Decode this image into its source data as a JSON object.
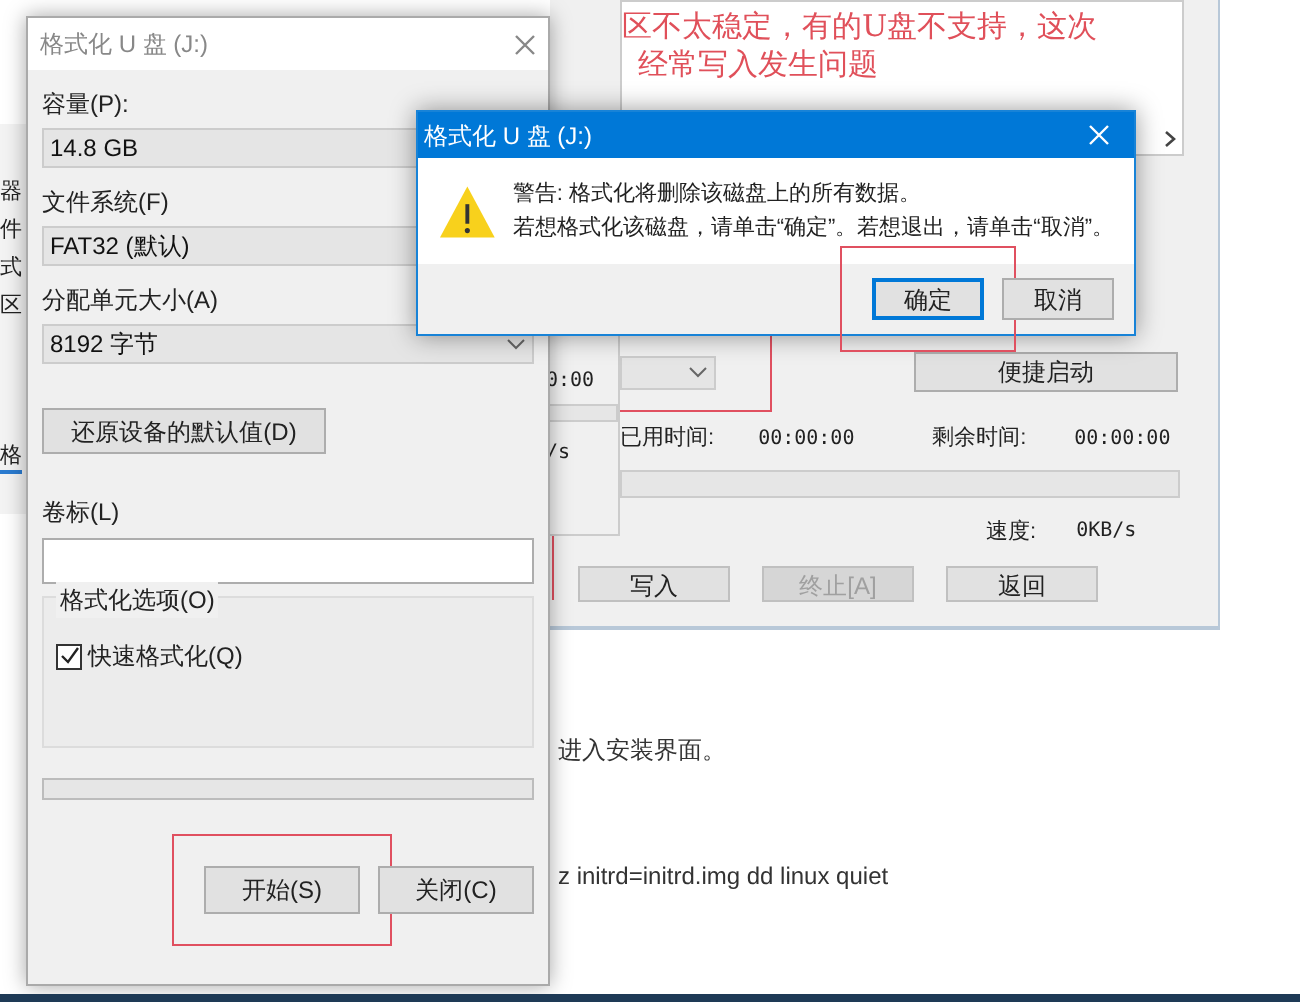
{
  "background_article": {
    "side_labels": [
      "器",
      "件",
      "式",
      "区",
      "格"
    ],
    "paragraphs": [
      "进入安装界面。",
      "z initrd=initrd.img dd linux quiet"
    ]
  },
  "annotation": {
    "lines": [
      "区不太稳定，有的U盘不支持，这次",
      "经常写入发生问题"
    ]
  },
  "partial_window": {
    "texts": [
      "0:00",
      "/s"
    ]
  },
  "write_window": {
    "quick_boot_button": "便捷启动",
    "elapsed_label": "已用时间:",
    "elapsed": "00:00:00",
    "remaining_label": "剩余时间:",
    "remaining": "00:00:00",
    "progress": {
      "level": 0
    },
    "speed_label": "速度:",
    "speed": "0KB/s",
    "buttons": [
      {
        "label": "写入",
        "disabled": false
      },
      {
        "label": "终止[A]",
        "disabled": true
      },
      {
        "label": "返回",
        "disabled": false
      }
    ]
  },
  "format_dialog": {
    "title": "格式化 U 盘 (J:)",
    "fields": [
      {
        "label": "容量(P):",
        "value": "14.8 GB",
        "kind": "readonly"
      },
      {
        "label": "文件系统(F)",
        "value": "FAT32 (默认)",
        "kind": "select"
      },
      {
        "label": "分配单元大小(A)",
        "value": "8192 字节",
        "kind": "select"
      }
    ],
    "restore_button": "还原设备的默认值(D)",
    "volume_label": {
      "label": "卷标(L)"
    },
    "options_group": {
      "title": "格式化选项(O)",
      "quick_format": {
        "label": "快速格式化(Q)",
        "checked": true
      }
    },
    "progress": {
      "level": 0
    },
    "buttons": [
      {
        "label": "开始(S)",
        "annotated": true
      },
      {
        "label": "关闭(C)",
        "annotated": false
      }
    ]
  },
  "confirm_dialog": {
    "title": "格式化 U 盘 (J:)",
    "message_lines": [
      "警告: 格式化将删除该磁盘上的所有数据。",
      "若想格式化该磁盘，请单击“确定”。若想退出，请单击“取消”。"
    ],
    "buttons": [
      {
        "label": "确定",
        "default": true,
        "annotated": true
      },
      {
        "label": "取消",
        "default": false,
        "annotated": false
      }
    ]
  }
}
